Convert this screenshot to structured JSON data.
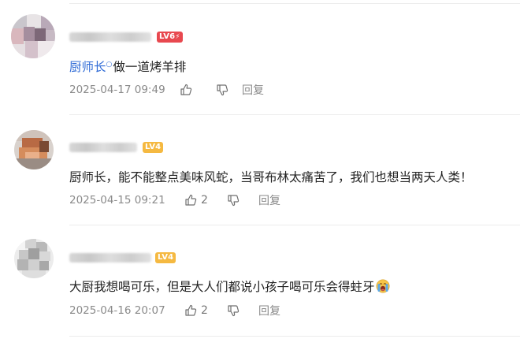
{
  "comments": [
    {
      "badge": {
        "text": "LV6",
        "color": "#e8484f",
        "has_bolt": true
      },
      "mention": "厨师长",
      "text": "做一道烤羊排",
      "time": "2025-04-17 09:49",
      "likes": "",
      "reply_label": "回复"
    },
    {
      "badge": {
        "text": "LV4",
        "color": "#f5b941",
        "has_bolt": false
      },
      "mention": "",
      "text": "厨师长，能不能整点美味风蛇，当哥布林太痛苦了，我们也想当两天人类！",
      "time": "2025-04-15 09:21",
      "likes": "2",
      "reply_label": "回复"
    },
    {
      "badge": {
        "text": "LV4",
        "color": "#f5b941",
        "has_bolt": false
      },
      "mention": "",
      "text": "大厨我想喝可乐，但是大人们都说小孩子喝可乐会得蛀牙",
      "emoji": "crying-emoji",
      "time": "2025-04-16 20:07",
      "likes": "2",
      "reply_label": "回复"
    }
  ],
  "colors": {
    "mention": "#2f6bd6",
    "meta_text": "#8a8a8a",
    "body_text": "#222222",
    "divider": "#ececec"
  }
}
